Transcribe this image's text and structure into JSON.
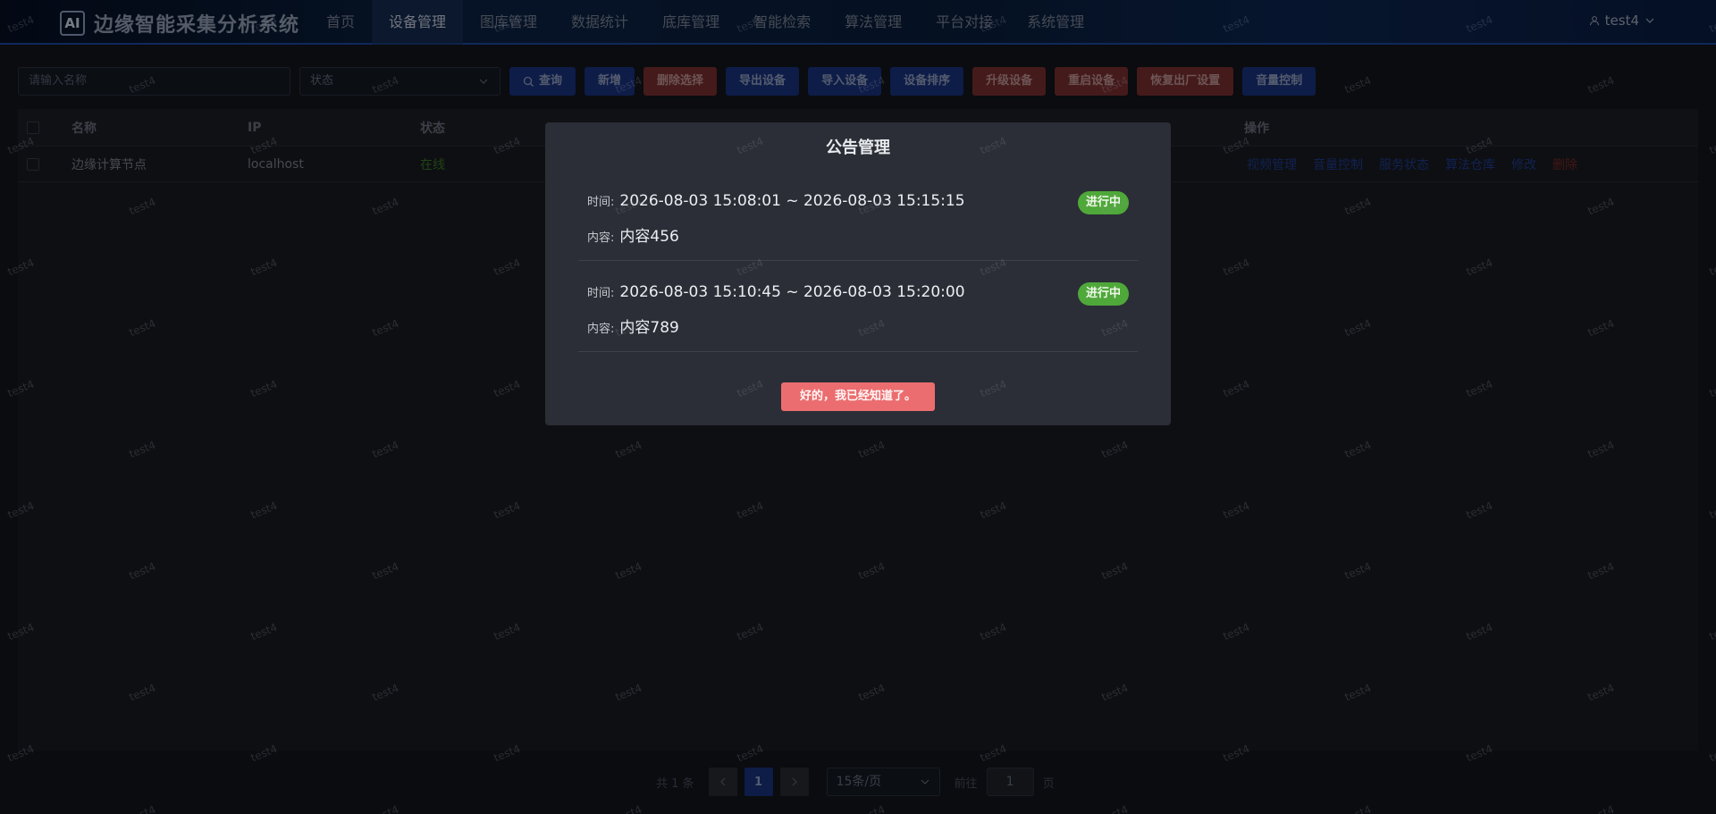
{
  "app": {
    "logo_badge": "AI",
    "title": "边缘智能采集分析系统"
  },
  "nav": [
    {
      "label": "首页",
      "active": false
    },
    {
      "label": "设备管理",
      "active": true
    },
    {
      "label": "图库管理",
      "active": false
    },
    {
      "label": "数据统计",
      "active": false
    },
    {
      "label": "底库管理",
      "active": false
    },
    {
      "label": "智能检索",
      "active": false
    },
    {
      "label": "算法管理",
      "active": false
    },
    {
      "label": "平台对接",
      "active": false
    },
    {
      "label": "系统管理",
      "active": false
    }
  ],
  "user": {
    "name": "test4"
  },
  "toolbar": {
    "name_placeholder": "请输入名称",
    "status_placeholder": "状态",
    "query_label": "查询",
    "add_label": "新增",
    "delete_selected_label": "删除选择",
    "export_label": "导出设备",
    "import_label": "导入设备",
    "sort_label": "设备排序",
    "upgrade_label": "升级设备",
    "restart_label": "重启设备",
    "factory_reset_label": "恢复出厂设置",
    "volume_label": "音量控制"
  },
  "table": {
    "columns": [
      "名称",
      "IP",
      "状态",
      "操作"
    ],
    "rows": [
      {
        "name": "边缘计算节点",
        "ip": "localhost",
        "status": "在线",
        "ops": [
          "视频管理",
          "音量控制",
          "服务状态",
          "算法仓库",
          "修改",
          "删除"
        ]
      }
    ]
  },
  "pagination": {
    "total": "共 1 条",
    "current": "1",
    "page_size": "15条/页",
    "goto_prefix": "前往",
    "goto_value": "1",
    "goto_suffix": "页"
  },
  "modal": {
    "title": "公告管理",
    "time_label": "时间:",
    "content_label": "内容:",
    "notices": [
      {
        "time": "2026-08-03 15:08:01 ~ 2026-08-03 15:15:15",
        "content": "内容456",
        "status": "进行中"
      },
      {
        "time": "2026-08-03 15:10:45 ~ 2026-08-03 15:20:00",
        "content": "内容789",
        "status": "进行中"
      }
    ],
    "confirm_label": "好的，我已经知道了。"
  },
  "watermark": "test4",
  "colors": {
    "primary_button": "#1a3383",
    "danger_button": "#7f3032",
    "badge_green": "#4fa83a",
    "confirm_red": "#ec6d6f"
  }
}
